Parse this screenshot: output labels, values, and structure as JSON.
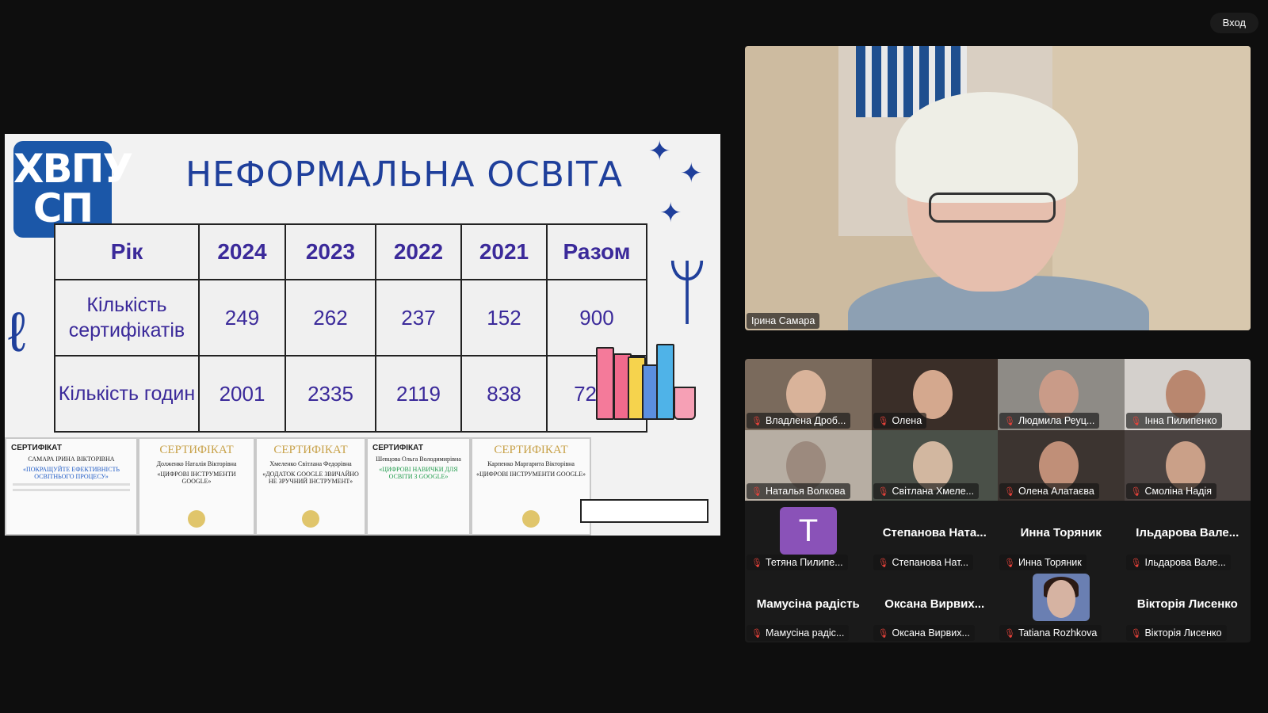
{
  "topbar": {
    "enter_label": "Вход"
  },
  "slide": {
    "logo_line1": "ХВПУ",
    "logo_line2": "СП",
    "title": "НЕФОРМАЛЬНА ОСВІТА",
    "table": {
      "header": [
        "Рік",
        "2024",
        "2023",
        "2022",
        "2021",
        "Разом"
      ],
      "rows": [
        {
          "label": "Кількість сертифікатів",
          "values": [
            "249",
            "262",
            "237",
            "152",
            "900"
          ]
        },
        {
          "label": "Кількість годин",
          "values": [
            "2001",
            "2335",
            "2119",
            "838",
            "7293"
          ]
        }
      ]
    },
    "certificates": [
      {
        "heading": "СЕРТИФІКАТ",
        "name": "САМАРА ІРИНА ВІКТОРІВНА",
        "course": "«ПОКРАЩУЙТЕ ЕФЕКТИВНІСТЬ ОСВІТНЬОГО ПРОЦЕСУ»"
      },
      {
        "heading": "СЕРТИФІКАТ",
        "name": "Долженко Наталія Вікторівна",
        "course": "«ЦИФРОВІ ІНСТРУМЕНТИ GOOGLE»"
      },
      {
        "heading": "СЕРТИФІКАТ",
        "name": "Хмеленко Світлана Федорівна",
        "course": "«ДОДАТОК GOOGLE ЗВИЧАЙНО НЕ ЗРУЧНИЙ ІНСТРУМЕНТ»"
      },
      {
        "heading": "СЕРТИФІКАТ",
        "name": "Шевцова Ольга Володимирівна",
        "course": "«ЦИФРОВІ НАВИЧКИ ДЛЯ ОСВІТИ З GOOGLE»"
      },
      {
        "heading": "СЕРТИФІКАТ",
        "name": "Карпенко Маргарита Вікторівна",
        "course": "«ЦИФРОВІ ІНСТРУМЕНТИ GOOGLE»"
      }
    ]
  },
  "speaker": {
    "name": "Ірина Самара"
  },
  "gallery": {
    "tiles": [
      {
        "name": "Владлена Дроб...",
        "kind": "video",
        "bg": "#7a6a5c",
        "face": "#d9b39a"
      },
      {
        "name": "Олена",
        "kind": "video",
        "bg": "#3a2e28",
        "face": "#d4a88e"
      },
      {
        "name": "Людмила Реуц...",
        "kind": "video",
        "bg": "#8e8b86",
        "face": "#c99b88"
      },
      {
        "name": "Інна Пилипенко",
        "kind": "video",
        "bg": "#d4d0cc",
        "face": "#b9876f"
      },
      {
        "name": "Наталья Волкова",
        "kind": "video",
        "bg": "#b7aea3",
        "face": "#9c8a7e"
      },
      {
        "name": "Світлана Хмеле...",
        "kind": "video",
        "bg": "#4a5048",
        "face": "#d2b7a0"
      },
      {
        "name": "Олена Алатаєва",
        "kind": "video",
        "bg": "#3c3430",
        "face": "#c08f78"
      },
      {
        "name": "Смоліна Надія",
        "kind": "video",
        "bg": "#4a4240",
        "face": "#caa088"
      },
      {
        "name": "Тетяна Пилипе...",
        "kind": "avatar",
        "letter": "T"
      },
      {
        "name": "Степанова Нат...",
        "kind": "text",
        "big": "Степанова Ната..."
      },
      {
        "name": "Инна Торяник",
        "kind": "text",
        "big": "Инна Торяник"
      },
      {
        "name": "Ільдарова Вале...",
        "kind": "text",
        "big": "Ільдарова Вале..."
      },
      {
        "name": "Мамусіна радіс...",
        "kind": "text",
        "big": "Мамусіна радість"
      },
      {
        "name": "Оксана Вирвих...",
        "kind": "text",
        "big": "Оксана Вирвих..."
      },
      {
        "name": "Tatiana Rozhkova",
        "kind": "photo"
      },
      {
        "name": "Вікторія Лисенко",
        "kind": "text",
        "big": "Вікторія Лисенко"
      }
    ]
  }
}
